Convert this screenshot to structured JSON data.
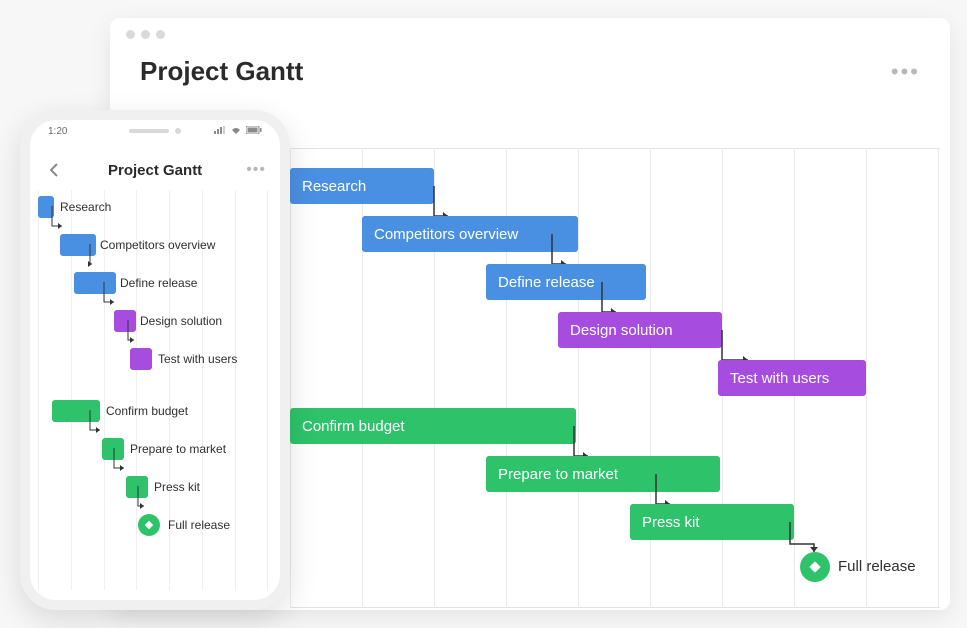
{
  "colors": {
    "blue": "#4a90e2",
    "purple": "#a64de0",
    "green": "#2ec36a"
  },
  "desktop": {
    "title": "Project Gantt",
    "tasks": [
      {
        "id": "research",
        "label": "Research",
        "color": "blue"
      },
      {
        "id": "competitors",
        "label": "Competitors overview",
        "color": "blue"
      },
      {
        "id": "define",
        "label": "Define release",
        "color": "blue"
      },
      {
        "id": "design",
        "label": "Design solution",
        "color": "purple"
      },
      {
        "id": "test",
        "label": "Test with users",
        "color": "purple"
      },
      {
        "id": "budget",
        "label": "Confirm budget",
        "color": "green"
      },
      {
        "id": "market",
        "label": "Prepare to market",
        "color": "green"
      },
      {
        "id": "press",
        "label": "Press kit",
        "color": "green"
      }
    ],
    "milestone": {
      "id": "full-release",
      "label": "Full release",
      "color": "green"
    }
  },
  "phone": {
    "time": "1:20",
    "title": "Project Gantt",
    "tasks": [
      {
        "id": "research",
        "label": "Research",
        "color": "blue"
      },
      {
        "id": "competitors",
        "label": "Competitors overview",
        "color": "blue"
      },
      {
        "id": "define",
        "label": "Define release",
        "color": "blue"
      },
      {
        "id": "design",
        "label": "Design solution",
        "color": "purple"
      },
      {
        "id": "test",
        "label": "Test with users",
        "color": "purple"
      },
      {
        "id": "budget",
        "label": "Confirm budget",
        "color": "green"
      },
      {
        "id": "market",
        "label": "Prepare to market",
        "color": "green"
      },
      {
        "id": "press",
        "label": "Press kit",
        "color": "green"
      }
    ],
    "milestone": {
      "id": "full-release",
      "label": "Full release",
      "color": "green"
    }
  },
  "chart_data": {
    "type": "gantt",
    "title": "Project Gantt",
    "tasks": [
      {
        "id": "research",
        "name": "Research",
        "start": 0,
        "end": 2,
        "row": 0,
        "color": "blue",
        "depends_on": null
      },
      {
        "id": "competitors",
        "name": "Competitors overview",
        "start": 1,
        "end": 4,
        "row": 1,
        "color": "blue",
        "depends_on": "research"
      },
      {
        "id": "define",
        "name": "Define release",
        "start": 3,
        "end": 5,
        "row": 2,
        "color": "blue",
        "depends_on": "competitors"
      },
      {
        "id": "design",
        "name": "Design solution",
        "start": 4,
        "end": 6,
        "row": 3,
        "color": "purple",
        "depends_on": "define"
      },
      {
        "id": "test",
        "name": "Test with users",
        "start": 6,
        "end": 8,
        "row": 4,
        "color": "purple",
        "depends_on": "design"
      },
      {
        "id": "budget",
        "name": "Confirm budget",
        "start": 0,
        "end": 4,
        "row": 5,
        "color": "green",
        "depends_on": null
      },
      {
        "id": "market",
        "name": "Prepare to market",
        "start": 3,
        "end": 6,
        "row": 6,
        "color": "green",
        "depends_on": "budget"
      },
      {
        "id": "press",
        "name": "Press kit",
        "start": 5,
        "end": 7,
        "row": 7,
        "color": "green",
        "depends_on": "market"
      }
    ],
    "milestones": [
      {
        "id": "full-release",
        "name": "Full release",
        "at": 7,
        "row": 8,
        "color": "green",
        "depends_on": "press"
      }
    ],
    "x_range": [
      0,
      9
    ]
  }
}
